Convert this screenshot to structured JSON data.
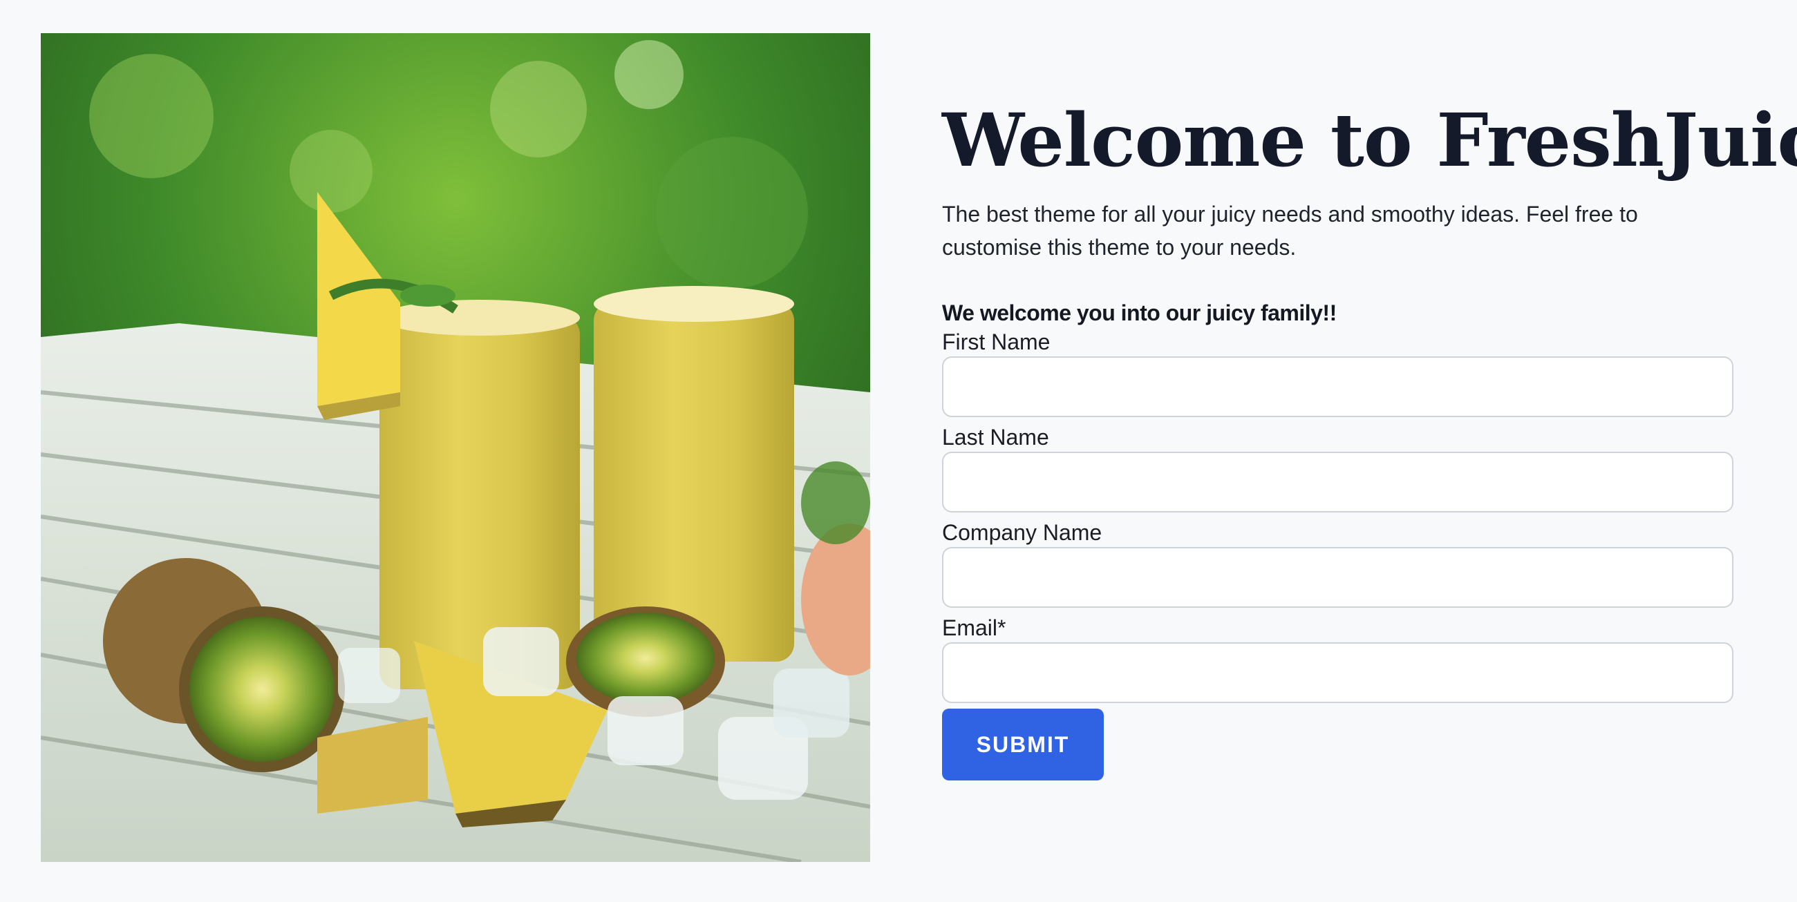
{
  "hero": {
    "alt": "Two glasses of kiwi pineapple smoothie on a white wooden table with kiwi halves, pineapple wedges and ice cubes"
  },
  "header": {
    "title": "Welcome to FreshJuice"
  },
  "intro": {
    "text": "The best theme for all your juicy needs and smoothy ideas. Feel free to customise this theme to your needs."
  },
  "form": {
    "heading": "We welcome you into our juicy family!!",
    "fields": [
      {
        "label": "First Name",
        "value": ""
      },
      {
        "label": "Last Name",
        "value": ""
      },
      {
        "label": "Company Name",
        "value": ""
      },
      {
        "label": "Email*",
        "value": ""
      }
    ],
    "submit_label": "SUBMIT"
  },
  "colors": {
    "background": "#f8f9fb",
    "title": "#141a2a",
    "button": "#2f63e4",
    "input_border": "#cfd3d9"
  }
}
